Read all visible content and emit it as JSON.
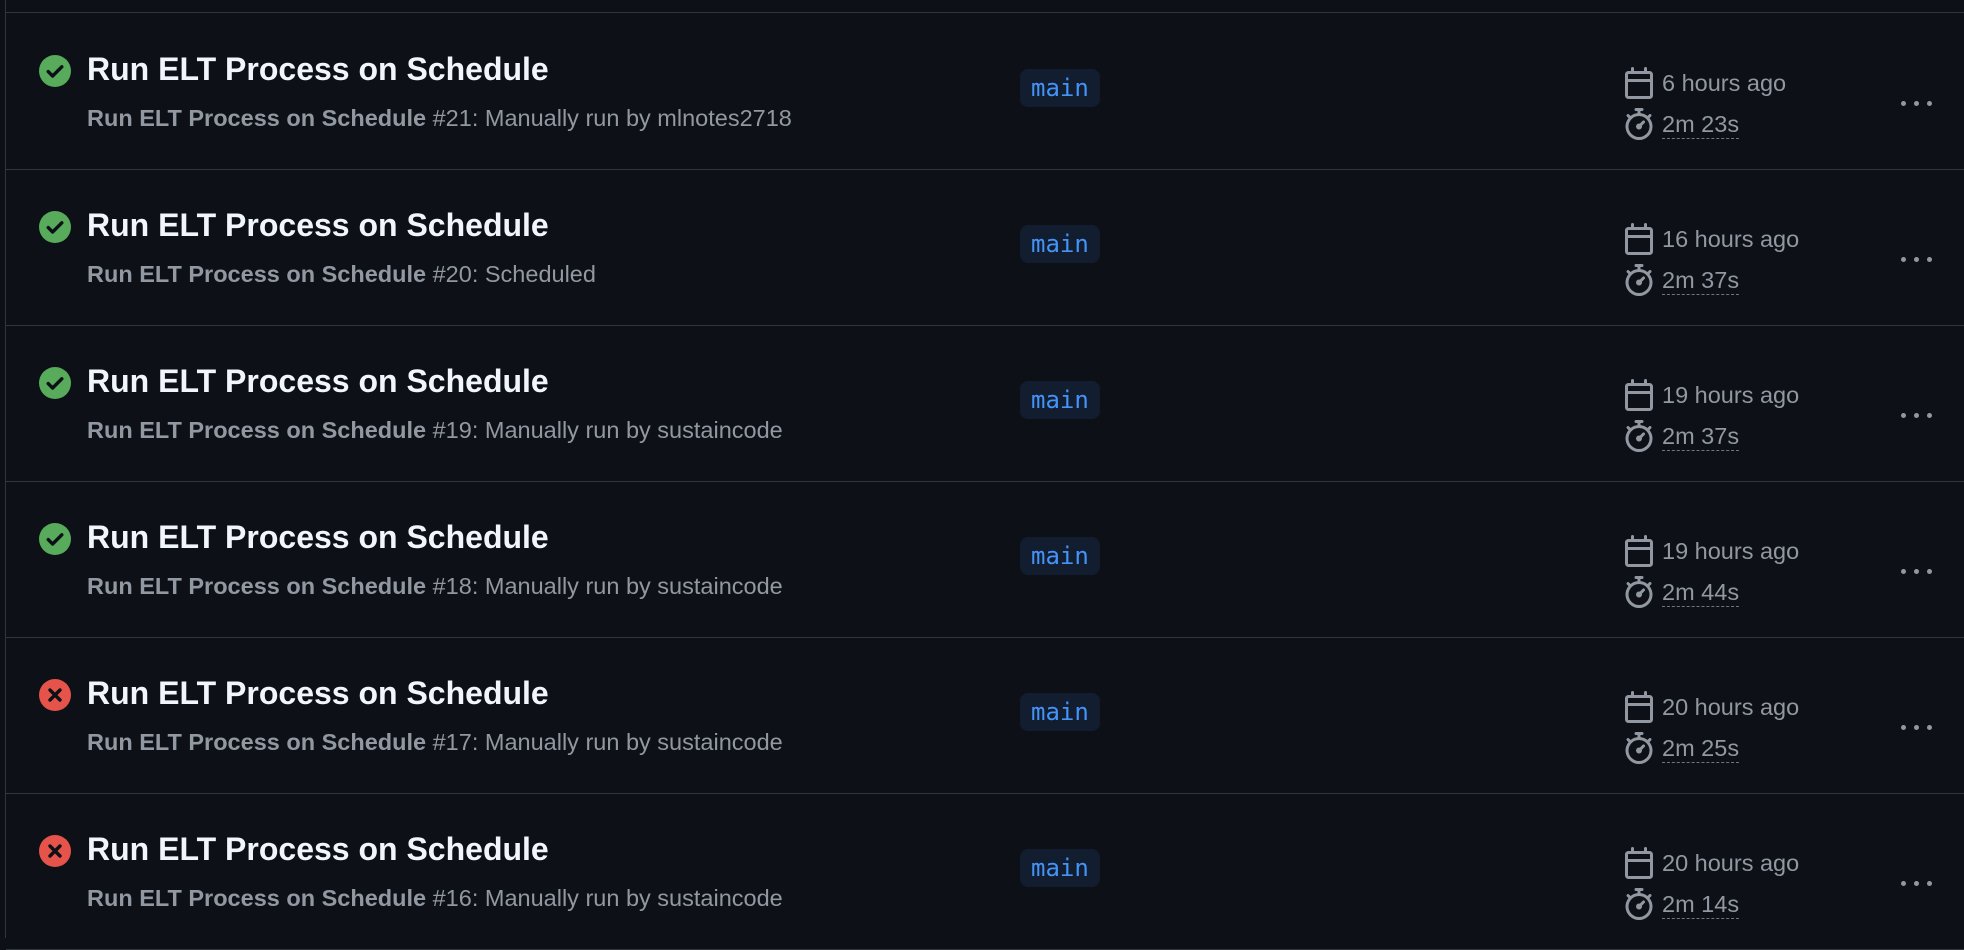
{
  "runs": [
    {
      "status": "success",
      "title": "Run ELT Process on Schedule",
      "workflow": "Run ELT Process on Schedule",
      "run_number": "#21",
      "trigger": ": Manually run by mlnotes2718",
      "branch": "main",
      "when": "6 hours ago",
      "duration": "2m 23s"
    },
    {
      "status": "success",
      "title": "Run ELT Process on Schedule",
      "workflow": "Run ELT Process on Schedule",
      "run_number": "#20",
      "trigger": ": Scheduled",
      "branch": "main",
      "when": "16 hours ago",
      "duration": "2m 37s"
    },
    {
      "status": "success",
      "title": "Run ELT Process on Schedule",
      "workflow": "Run ELT Process on Schedule",
      "run_number": "#19",
      "trigger": ": Manually run by sustaincode",
      "branch": "main",
      "when": "19 hours ago",
      "duration": "2m 37s"
    },
    {
      "status": "success",
      "title": "Run ELT Process on Schedule",
      "workflow": "Run ELT Process on Schedule",
      "run_number": "#18",
      "trigger": ": Manually run by sustaincode",
      "branch": "main",
      "when": "19 hours ago",
      "duration": "2m 44s"
    },
    {
      "status": "failure",
      "title": "Run ELT Process on Schedule",
      "workflow": "Run ELT Process on Schedule",
      "run_number": "#17",
      "trigger": ": Manually run by sustaincode",
      "branch": "main",
      "when": "20 hours ago",
      "duration": "2m 25s"
    },
    {
      "status": "failure",
      "title": "Run ELT Process on Schedule",
      "workflow": "Run ELT Process on Schedule",
      "run_number": "#16",
      "trigger": ": Manually run by sustaincode",
      "branch": "main",
      "when": "20 hours ago",
      "duration": "2m 14s"
    }
  ],
  "icons": {
    "success": "check-circle-fill-icon",
    "failure": "x-circle-fill-icon",
    "date": "calendar-icon",
    "duration": "stopwatch-icon",
    "menu": "kebab-horizontal-icon"
  },
  "colors": {
    "success": "#57ab5a",
    "failure": "#e5534b",
    "branch_text": "#4493f8",
    "branch_bg": "#121d2f"
  }
}
